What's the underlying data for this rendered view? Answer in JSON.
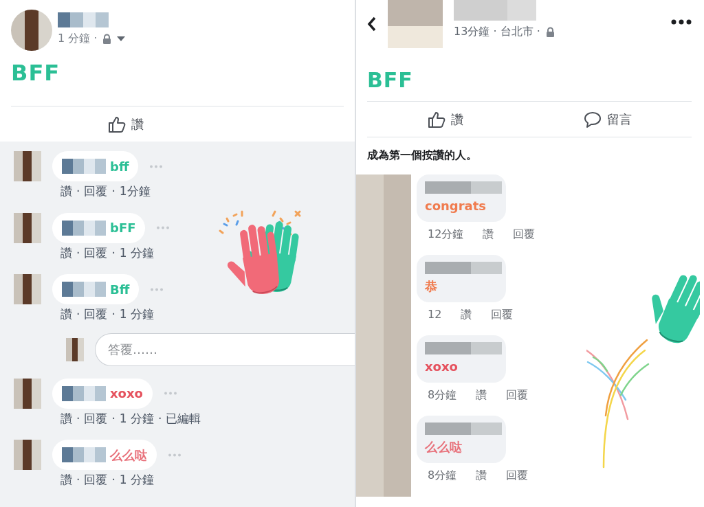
{
  "left_post": {
    "meta": "1 分鐘 ·",
    "body": "BFF",
    "separator": "·",
    "actions": [
      {
        "label": "讚",
        "kind": "like"
      }
    ],
    "comments": [
      {
        "text": "bff",
        "color": "#2bbf95",
        "actions": [
          "讚",
          "回覆",
          "1分鐘"
        ]
      },
      {
        "text": "bFF",
        "color": "#2bbf95",
        "actions": [
          "讚",
          "回覆",
          "1 分鐘"
        ]
      },
      {
        "text": "Bff",
        "color": "#2bbf95",
        "actions": [
          "讚",
          "回覆",
          "1 分鐘"
        ],
        "reply_field": {
          "placeholder": "答覆……"
        }
      },
      {
        "text": "xoxo",
        "color": "#e5525e",
        "actions": [
          "讚",
          "回覆",
          "1 分鐘",
          "已編輯"
        ]
      },
      {
        "text": "么么哒",
        "color": "#e8707a",
        "actions": [
          "讚",
          "回覆",
          "1 分鐘"
        ]
      }
    ]
  },
  "right_post": {
    "meta": "13分鐘 · 台北市 ·",
    "body": "BFF",
    "actions": [
      {
        "label": "讚",
        "kind": "like"
      },
      {
        "label": "留言",
        "kind": "comment"
      }
    ],
    "likes_prompt": "成為第一個按讚的人。",
    "comments": [
      {
        "text": "congrats",
        "color": "#f07b4e",
        "actions": [
          "12分鐘",
          "讚",
          "回覆"
        ]
      },
      {
        "text": "恭",
        "color": "#f07b4e",
        "actions": [
          "12",
          "讚",
          "回覆"
        ]
      },
      {
        "text": "xoxo",
        "color": "#e5525e",
        "actions": [
          "8分鐘",
          "讚",
          "回覆"
        ]
      },
      {
        "text": "么么哒",
        "color": "#e8707a",
        "actions": [
          "8分鐘",
          "讚",
          "回覆"
        ]
      }
    ]
  }
}
